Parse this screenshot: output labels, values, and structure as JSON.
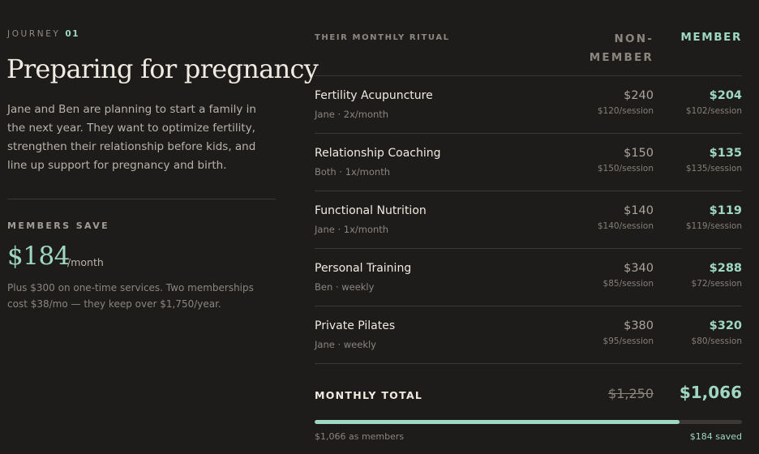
{
  "journey": {
    "label": "JOURNEY",
    "number": "01",
    "title": "Preparing for pregnancy",
    "description": "Jane and Ben are planning to start a family in the next year. They want to optimize fertility, strengthen their relationship before kids, and line up support for pregnancy and birth."
  },
  "savings": {
    "label": "MEMBERS SAVE",
    "amount": "$184",
    "unit": "/month",
    "note": "Plus $300 on one-time services. Two memberships cost $38/mo — they keep over $1,750/year."
  },
  "table": {
    "section_label": "THEIR MONTHLY RITUAL",
    "col_non_member": "NON-MEMBER",
    "col_member": "MEMBER",
    "rows": [
      {
        "name": "Fertility Acupuncture",
        "detail": "Jane · 2x/month",
        "non_price": "$240",
        "non_rate": "$120/session",
        "mem_price": "$204",
        "mem_rate": "$102/session"
      },
      {
        "name": "Relationship Coaching",
        "detail": "Both · 1x/month",
        "non_price": "$150",
        "non_rate": "$150/session",
        "mem_price": "$135",
        "mem_rate": "$135/session"
      },
      {
        "name": "Functional Nutrition",
        "detail": "Jane · 1x/month",
        "non_price": "$140",
        "non_rate": "$140/session",
        "mem_price": "$119",
        "mem_rate": "$119/session"
      },
      {
        "name": "Personal Training",
        "detail": "Ben · weekly",
        "non_price": "$340",
        "non_rate": "$85/session",
        "mem_price": "$288",
        "mem_rate": "$72/session"
      },
      {
        "name": "Private Pilates",
        "detail": "Jane · weekly",
        "non_price": "$380",
        "non_rate": "$95/session",
        "mem_price": "$320",
        "mem_rate": "$80/session"
      }
    ],
    "total_label": "MONTHLY TOTAL",
    "total_non_member": "$1,250",
    "total_member": "$1,066"
  },
  "progress": {
    "fraction": 0.853,
    "left_label": "$1,066 as members",
    "right_label": "$184 saved"
  },
  "colors": {
    "accent": "#9ed8c2",
    "background": "#1e1c1b",
    "text": "#efeae2",
    "muted": "#8a857f"
  }
}
